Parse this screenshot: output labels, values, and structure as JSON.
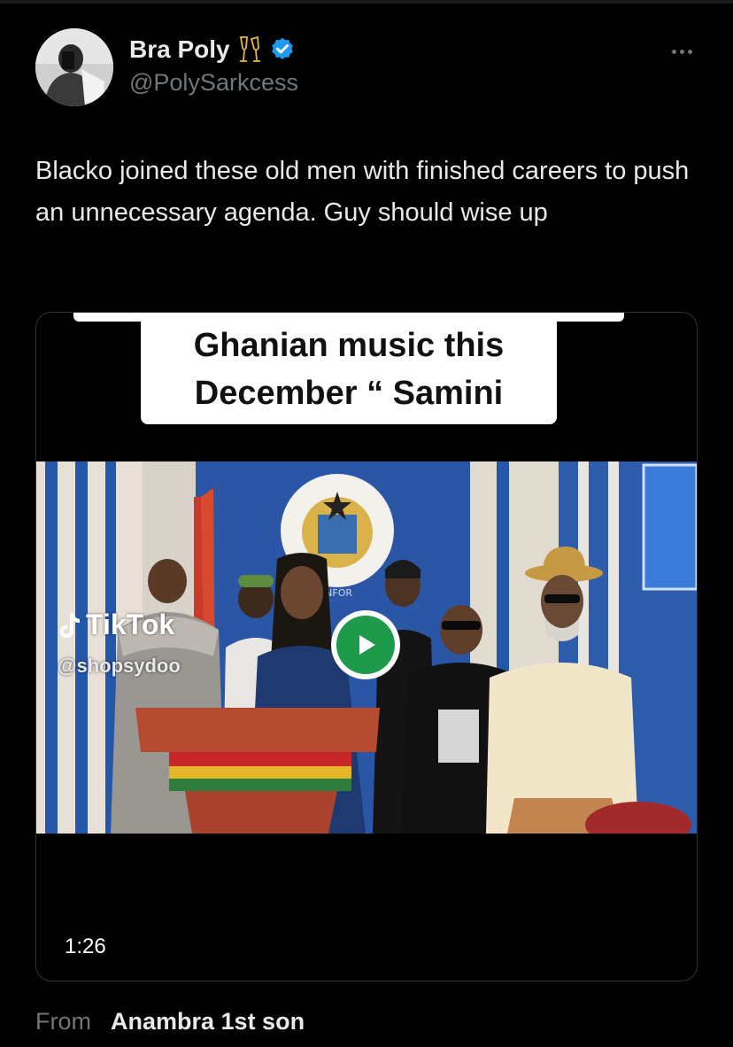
{
  "post": {
    "author": {
      "display_name": "Bra Poly",
      "handle": "@PolySarkcess",
      "emoji_icon": "clinking-glasses-icon",
      "verified_icon": "verified-badge-icon",
      "verified_color": "#1d9bf0"
    },
    "more_icon": "more-dots-icon",
    "text": "Blacko joined these old men with finished careers to push an unnecessary agenda. Guy should wise up",
    "media": {
      "caption_line1": "Ghanian music this",
      "caption_line2": "December “ Samini",
      "watermark_logo": "TikTok",
      "watermark_handle": "@shopsydoo",
      "banner_text": "INFOR",
      "play_icon": "play-icon",
      "play_color": "#1d9a4a",
      "duration": "1:26"
    },
    "from": {
      "label": "From",
      "name": "Anambra 1st son"
    }
  }
}
